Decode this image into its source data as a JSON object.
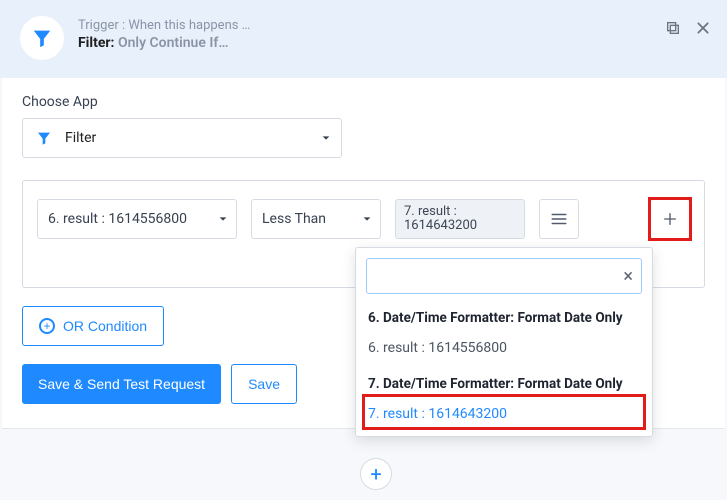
{
  "header": {
    "trigger_label": "Trigger : When this happens …",
    "title_prefix": "Filter:",
    "title_suffix": "Only Continue If…"
  },
  "choose_app": {
    "label": "Choose App",
    "value": "Filter"
  },
  "rule": {
    "left_value": "6. result : 1614556800",
    "operator": "Less Than",
    "right_value_line1": "7. result :",
    "right_value_line2": "1614643200"
  },
  "or_button_label": "OR Condition",
  "buttons": {
    "save_send": "Save & Send Test Request",
    "save": "Save"
  },
  "popover": {
    "search_value": "",
    "sections": [
      {
        "title": "6. Date/Time Formatter: Format Date Only",
        "items": [
          "6. result : 1614556800"
        ]
      },
      {
        "title": "7. Date/Time Formatter: Format Date Only",
        "items": [
          "7. result : 1614643200"
        ]
      }
    ],
    "active_item": "7. result : 1614643200"
  },
  "plus_icon_label": "+"
}
